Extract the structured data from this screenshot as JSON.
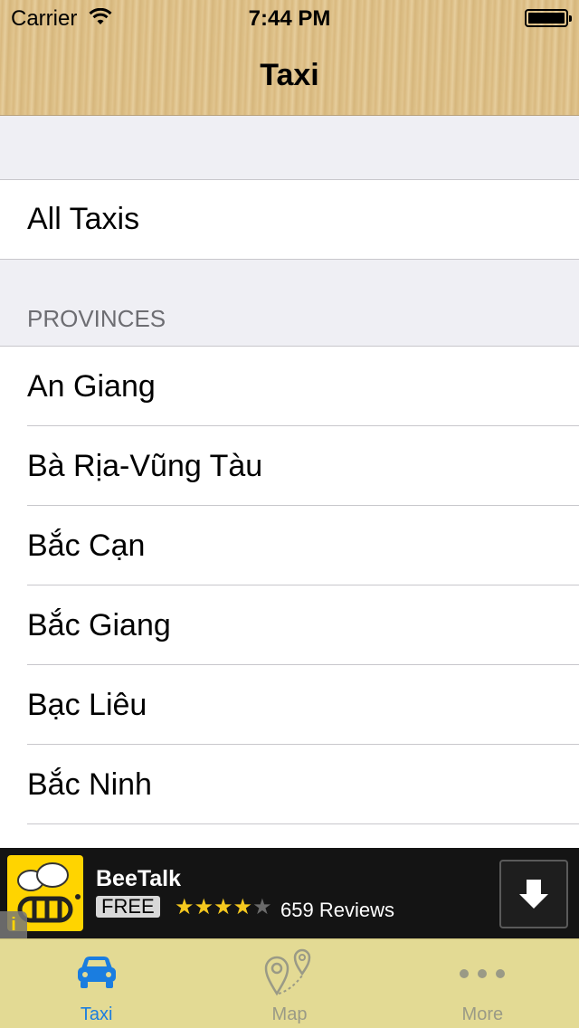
{
  "status_bar": {
    "carrier": "Carrier",
    "time": "7:44 PM"
  },
  "nav": {
    "title": "Taxi"
  },
  "list": {
    "all_taxis": "All Taxis",
    "section_header": "PROVINCES",
    "provinces": [
      "An Giang",
      "Bà Rịa-Vũng Tàu",
      "Bắc Cạn",
      "Bắc Giang",
      "Bạc Liêu",
      "Bắc Ninh"
    ]
  },
  "ad": {
    "app_name": "BeeTalk",
    "price": "FREE",
    "rating_stars": 4,
    "rating_max": 5,
    "reviews": "659 Reviews",
    "icon": "beetalk-logo-icon",
    "download_icon": "download-arrow-icon",
    "info_icon": "info-icon"
  },
  "tabbar": {
    "tabs": [
      {
        "label": "Taxi",
        "icon": "taxi-car-icon",
        "active": true
      },
      {
        "label": "Map",
        "icon": "map-pins-icon",
        "active": false
      },
      {
        "label": "More",
        "icon": "more-dots-icon",
        "active": false
      }
    ]
  },
  "colors": {
    "accent": "#1a7de0",
    "tabbar_bg": "#e3da94",
    "ad_bg": "#141414",
    "ad_icon_bg": "#ffd400",
    "star": "#f5c81f"
  }
}
